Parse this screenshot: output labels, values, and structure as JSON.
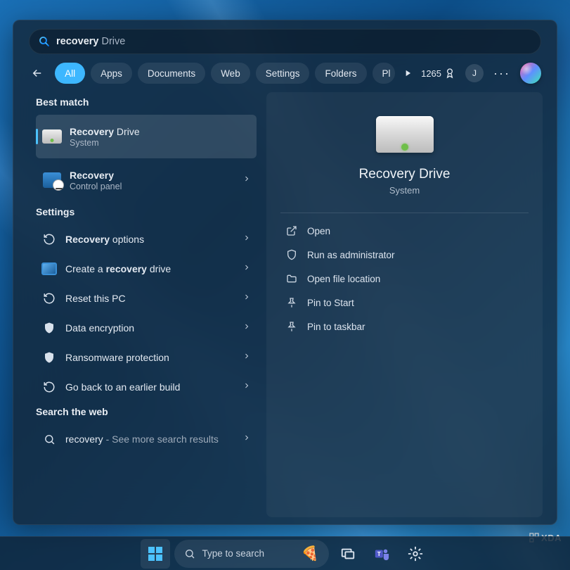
{
  "search": {
    "query_bold": "recovery",
    "query_rest": " Drive"
  },
  "tabs": {
    "all": "All",
    "apps": "Apps",
    "documents": "Documents",
    "web": "Web",
    "settings": "Settings",
    "folders": "Folders",
    "photos": "Pl"
  },
  "points": "1265",
  "user_initial": "J",
  "sections": {
    "best_match": "Best match",
    "settings": "Settings",
    "search_web": "Search the web"
  },
  "results": {
    "recovery_drive": {
      "bold": "Recovery",
      "rest": " Drive",
      "sub": "System"
    },
    "recovery_cp": {
      "bold": "Recovery",
      "rest": "",
      "sub": "Control panel"
    }
  },
  "settings_items": {
    "recovery_options": {
      "bold": "Recovery",
      "rest": " options"
    },
    "create_recovery_drive": {
      "pre": "Create a ",
      "bold": "recovery",
      "post": " drive"
    },
    "reset_pc": {
      "text": "Reset this PC"
    },
    "data_encryption": {
      "text": "Data encryption"
    },
    "ransomware": {
      "text": "Ransomware protection"
    },
    "go_back": {
      "text": "Go back to an earlier build"
    }
  },
  "web_search": {
    "bold": "recovery",
    "rest": " - See more search results"
  },
  "preview": {
    "title": "Recovery Drive",
    "sub": "System",
    "actions": {
      "open": "Open",
      "run_admin": "Run as administrator",
      "open_loc": "Open file location",
      "pin_start": "Pin to Start",
      "pin_taskbar": "Pin to taskbar"
    }
  },
  "taskbar": {
    "search_placeholder": "Type to search"
  },
  "watermark": "XDA"
}
